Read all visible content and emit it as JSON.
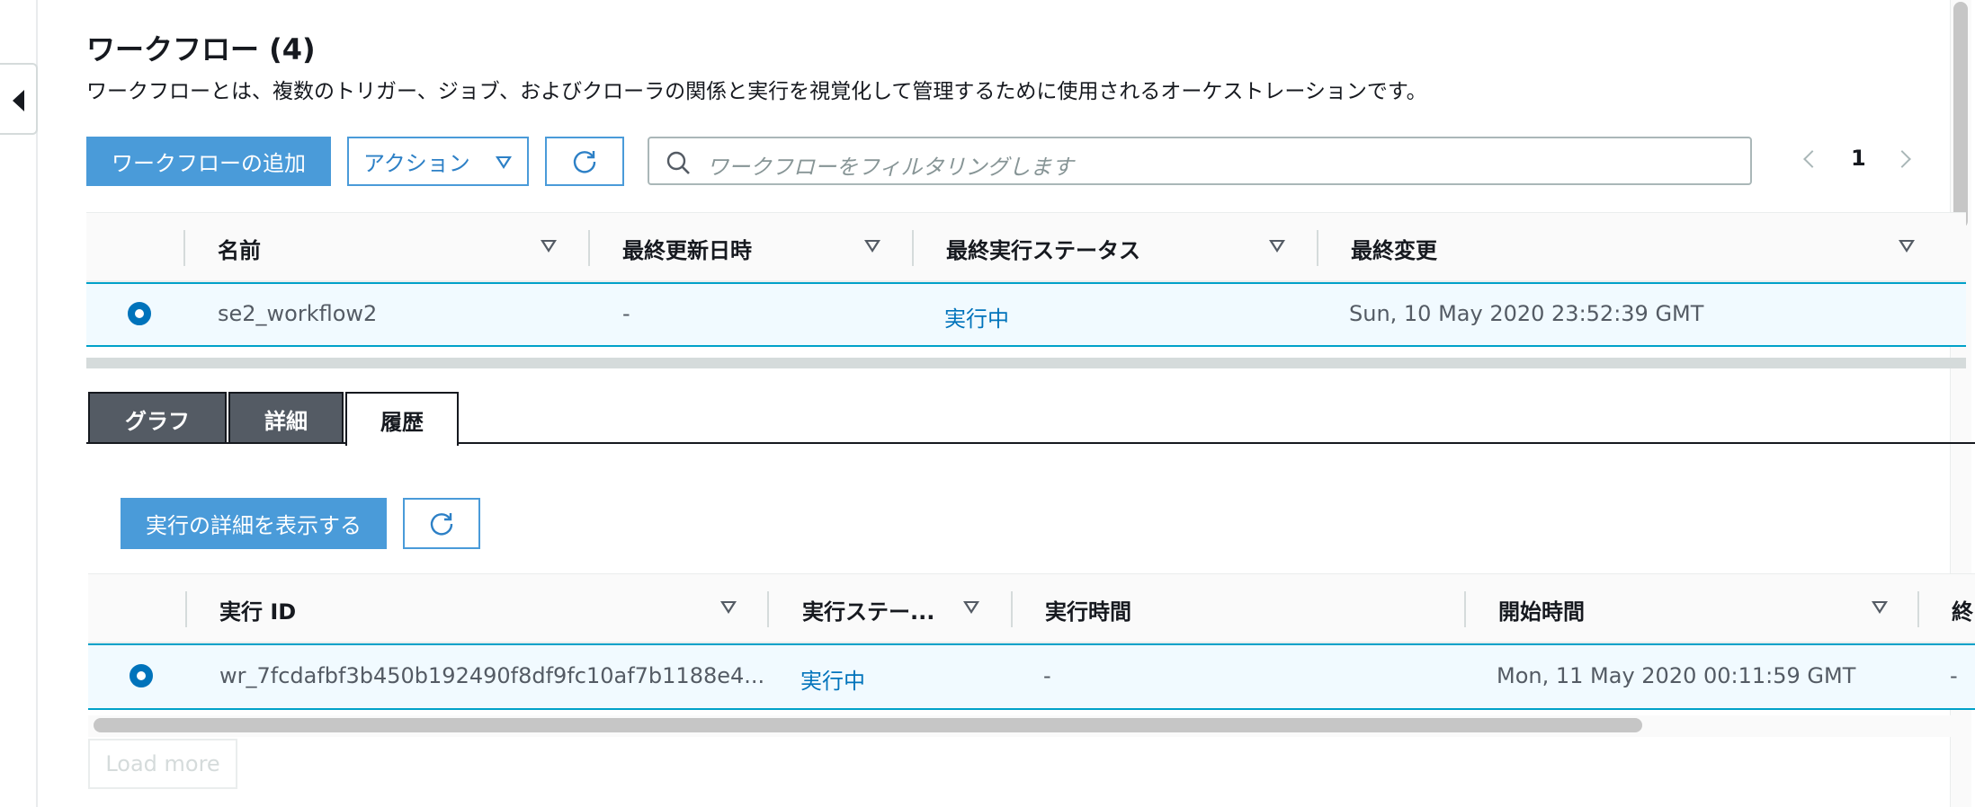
{
  "page": {
    "title": "ワークフロー (4)",
    "description": "ワークフローとは、複数のトリガー、ジョブ、およびクローラの関係と実行を視覚化して管理するために使用されるオーケストレーションです。"
  },
  "toolbar": {
    "add_workflow_label": "ワークフローの追加",
    "actions_label": "アクション",
    "refresh_icon": "refresh-icon",
    "search_placeholder": "ワークフローをフィルタリングします",
    "page_number": "1"
  },
  "workflow_table": {
    "columns": [
      "名前",
      "最終更新日時",
      "最終実行ステータス",
      "最終変更"
    ],
    "rows": [
      {
        "name": "se2_workflow2",
        "last_updated": "-",
        "last_run_status": "実行中",
        "last_modified": "Sun, 10 May 2020 23:52:39 GMT"
      }
    ]
  },
  "tabs": {
    "items": [
      {
        "label": "グラフ"
      },
      {
        "label": "詳細"
      },
      {
        "label": "履歴"
      }
    ],
    "active": "履歴"
  },
  "history": {
    "view_details_label": "実行の詳細を表示する",
    "columns": [
      "実行 ID",
      "実行ステー...",
      "実行時間",
      "開始時間",
      "終"
    ],
    "rows": [
      {
        "run_id": "wr_7fcdafbf3b450b192490f8df9fc10af7b1188e4...",
        "run_status": "実行中",
        "run_time": "-",
        "start_time": "Mon, 11 May 2020 00:11:59 GMT",
        "end": "-"
      }
    ],
    "load_more_label": "Load more"
  },
  "colors": {
    "primary_button": "#4a9bd9",
    "link": "#0073bb",
    "selected_row": "#f1faff",
    "tab_inactive": "#545b64"
  }
}
